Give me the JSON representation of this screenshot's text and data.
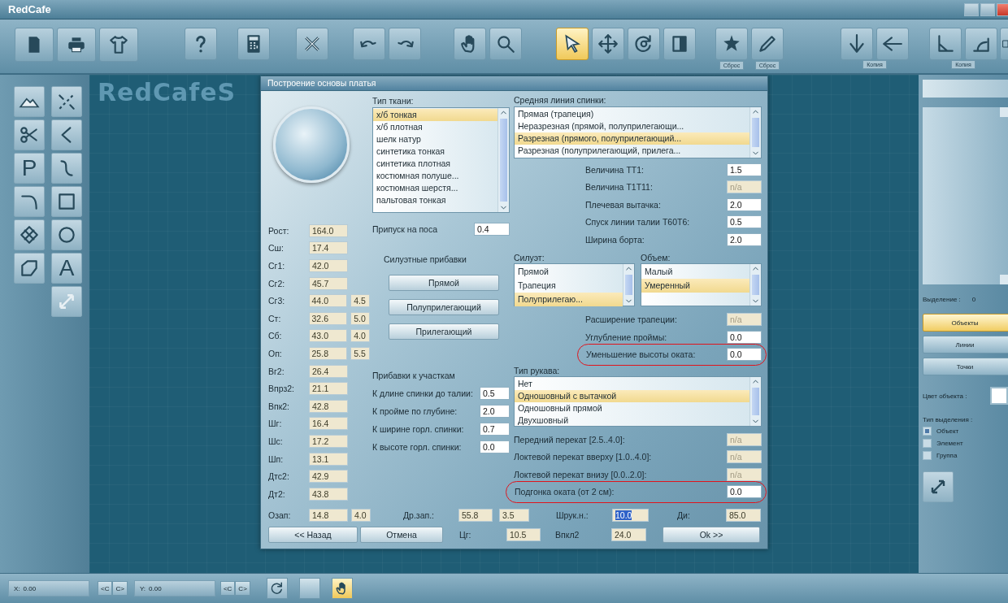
{
  "window": {
    "title": "RedCafe"
  },
  "toolbar": {
    "groups": [
      {
        "buttons": [
          {
            "selected": false
          },
          {
            "selected": false
          },
          {
            "selected": false
          }
        ]
      },
      {
        "buttons": [
          {
            "selected": false
          }
        ]
      },
      {
        "buttons": [
          {
            "selected": false
          }
        ]
      },
      {
        "buttons": [
          {
            "selected": false
          }
        ]
      },
      {
        "buttons": [
          {
            "selected": false
          },
          {
            "selected": false
          }
        ]
      },
      {
        "buttons": [
          {
            "selected": false
          },
          {
            "selected": false
          }
        ]
      },
      {
        "buttons": [
          {
            "selected": true
          },
          {
            "selected": false
          },
          {
            "selected": false
          },
          {
            "selected": false
          }
        ]
      },
      {
        "buttons": [
          {
            "selected": false,
            "caption": "Сброс"
          },
          {
            "selected": false,
            "caption": "Сброс"
          }
        ]
      },
      {
        "caption": "Копия",
        "buttons": [
          {
            "selected": false
          },
          {
            "selected": false
          }
        ]
      },
      {
        "caption": "Копия",
        "buttons": [
          {
            "selected": false
          },
          {
            "selected": false
          }
        ]
      },
      {
        "buttons": [
          {
            "selected": false
          }
        ]
      }
    ]
  },
  "palette": [
    {
      "kind": "tool"
    },
    {
      "kind": "tool"
    },
    {
      "kind": "tool"
    },
    {
      "kind": "tool"
    },
    {
      "kind": "glyph",
      "label": "P"
    },
    {
      "kind": "tool"
    },
    {
      "kind": "tool"
    },
    {
      "kind": "tool"
    },
    {
      "kind": "tool"
    },
    {
      "kind": "tool"
    },
    {
      "kind": "tool"
    },
    {
      "kind": "glyph",
      "label": "A"
    },
    {
      "kind": "tool"
    }
  ],
  "workspace": {
    "watermark": "RedCafeS"
  },
  "dialog": {
    "title": "Построение основы платья",
    "fabric": {
      "label": "Тип ткани:",
      "items": [
        {
          "text": "х/б тонкая",
          "selected": true
        },
        {
          "text": "х/б плотная",
          "selected": false
        },
        {
          "text": "шелк натур",
          "selected": false
        },
        {
          "text": "синтетика тонкая",
          "selected": false
        },
        {
          "text": "синтетика плотная",
          "selected": false
        },
        {
          "text": "костюмная полуше...",
          "selected": false
        },
        {
          "text": "костюмная шерстя...",
          "selected": false
        },
        {
          "text": "пальтовая тонкая",
          "selected": false
        }
      ]
    },
    "measurements": [
      {
        "label": "Рост:",
        "value": "164.0"
      },
      {
        "label": "Сш:",
        "value": "17.4"
      },
      {
        "label": "Сг1:",
        "value": "42.0"
      },
      {
        "label": "Сг2:",
        "value": "45.7"
      },
      {
        "label": "Сг3:",
        "value": "44.0",
        "extra": "4.5"
      },
      {
        "label": "Ст:",
        "value": "32.6",
        "extra": "5.0"
      },
      {
        "label": "Сб:",
        "value": "43.0",
        "extra": "4.0"
      },
      {
        "label": "Оп:",
        "value": "25.8",
        "extra": "5.5"
      },
      {
        "label": "Вг2:",
        "value": "26.4"
      },
      {
        "label": "Впрз2:",
        "value": "21.1"
      },
      {
        "label": "Впк2:",
        "value": "42.8"
      },
      {
        "label": "Шг:",
        "value": "16.4"
      },
      {
        "label": "Шс:",
        "value": "17.2"
      },
      {
        "label": "Шп:",
        "value": "13.1"
      },
      {
        "label": "Дтс2:",
        "value": "42.9"
      },
      {
        "label": "Дт2:",
        "value": "43.8"
      }
    ],
    "allowance": {
      "label": "Припуск  на поса",
      "value": "0.4"
    },
    "silhouette_additions": {
      "label": "Силуэтные  прибавки",
      "buttons": [
        "Прямой",
        "Полуприлегающий",
        "Прилегающий"
      ]
    },
    "area_additions": {
      "label": "Прибавки  к участкам",
      "rows": [
        {
          "label": "К длине спинки до талии:",
          "value": "0.5"
        },
        {
          "label": "К пройме по глубине:",
          "value": "2.0"
        },
        {
          "label": "К ширине горл. спинки:",
          "value": "0.7"
        },
        {
          "label": "К высоте горл. спинки:",
          "value": "0.0"
        }
      ]
    },
    "back_line": {
      "label": "Средняя линия спинки:",
      "items": [
        {
          "text": "Прямая (трапеция)",
          "selected": false
        },
        {
          "text": "Неразрезная (прямой, полуприлегающи...",
          "selected": false
        },
        {
          "text": "Разрезная (прямого, полуприлегающий...",
          "selected": true
        },
        {
          "text": "Разрезная (полуприлегающий, прилега...",
          "selected": false
        }
      ]
    },
    "params": [
      {
        "label": "Величина ТТ1:",
        "value": "1.5",
        "disabled": false,
        "highlighted": false
      },
      {
        "label": "Величина Т1Т11:",
        "value": "n/a",
        "disabled": true,
        "highlighted": false
      },
      {
        "label": "Плечевая вытачка:",
        "value": "2.0",
        "disabled": false,
        "highlighted": false
      },
      {
        "label": "Спуск линии талии Т60Т6:",
        "value": "0.5",
        "disabled": false,
        "highlighted": false
      },
      {
        "label": "Ширина борта:",
        "value": "2.0",
        "disabled": false,
        "highlighted": false
      }
    ],
    "silhouette": {
      "label": "Силуэт:",
      "items": [
        {
          "text": "Прямой",
          "selected": false
        },
        {
          "text": "Трапеция",
          "selected": false
        },
        {
          "text": "Полуприлегаю...",
          "selected": true
        }
      ]
    },
    "volume": {
      "label": "Объем:",
      "items": [
        {
          "text": "Малый",
          "selected": false
        },
        {
          "text": "Умеренный",
          "selected": true
        }
      ]
    },
    "params2": [
      {
        "label": "Расширение трапеции:",
        "value": "n/a",
        "disabled": true,
        "highlighted": false
      },
      {
        "label": "Углубление проймы:",
        "value": "0.0",
        "disabled": false,
        "highlighted": false
      },
      {
        "label": "Уменьшение высоты оката:",
        "value": "0.0",
        "disabled": false,
        "highlighted": true
      }
    ],
    "sleeve": {
      "label": "Тип рукава:",
      "items": [
        {
          "text": "Нет",
          "selected": false
        },
        {
          "text": "Одношовный с вытачкой",
          "selected": true
        },
        {
          "text": "Одношовный прямой",
          "selected": false
        },
        {
          "text": "Двухшовный",
          "selected": false
        }
      ]
    },
    "params3": [
      {
        "label": "Передний перекат [2.5..4.0]:",
        "value": "n/a",
        "disabled": true,
        "highlighted": false
      },
      {
        "label": "Локтевой перекат вверху [1.0..4.0]:",
        "value": "n/a",
        "disabled": true,
        "highlighted": false
      },
      {
        "label": "Локтевой перекат внизу [0.0..2.0]:",
        "value": "n/a",
        "disabled": true,
        "highlighted": false
      },
      {
        "label": "Подгонка оката (от 2 см):",
        "value": "0.0",
        "disabled": false,
        "highlighted": true
      }
    ],
    "footer_fields": [
      {
        "label": "Озап:",
        "value": "14.8",
        "extra": "4.0",
        "text_selected": false
      },
      {
        "label": "Др.зап.:",
        "value": "55.8",
        "extra": "3.5",
        "text_selected": false
      },
      {
        "label": "Шрук.н.:",
        "value": "10.0",
        "text_selected": true
      },
      {
        "label": "Ди:",
        "value": "85.0",
        "text_selected": false
      }
    ],
    "back_button": "<< Назад",
    "cancel_button": "Отмена",
    "footer_fields2": [
      {
        "label": "Цг:",
        "value": "10.5"
      },
      {
        "label": "Впкл2",
        "value": "24.0"
      }
    ],
    "ok_button": "Ok >>"
  },
  "side_panel": {
    "selection_label": "Выделение :",
    "selection_count": "0",
    "modes": [
      {
        "label": "Объекты",
        "selected": true
      },
      {
        "label": "Линии",
        "selected": false
      },
      {
        "label": "Точки",
        "selected": false
      }
    ],
    "color_label": "Цвет объекта :",
    "color": "#ffffff",
    "selection_type_label": "Тип выделения :",
    "selection_types": [
      {
        "label": "Объект",
        "checked": true
      },
      {
        "label": "Элемент",
        "checked": false
      },
      {
        "label": "Группа",
        "checked": false
      }
    ]
  },
  "status_bar": {
    "x_label": "X:",
    "x_value": "0.00",
    "x_buttons": [
      "<C",
      "C>"
    ],
    "y_label": "Y:",
    "y_value": "0.00",
    "y_buttons": [
      "<C",
      "C>"
    ]
  }
}
